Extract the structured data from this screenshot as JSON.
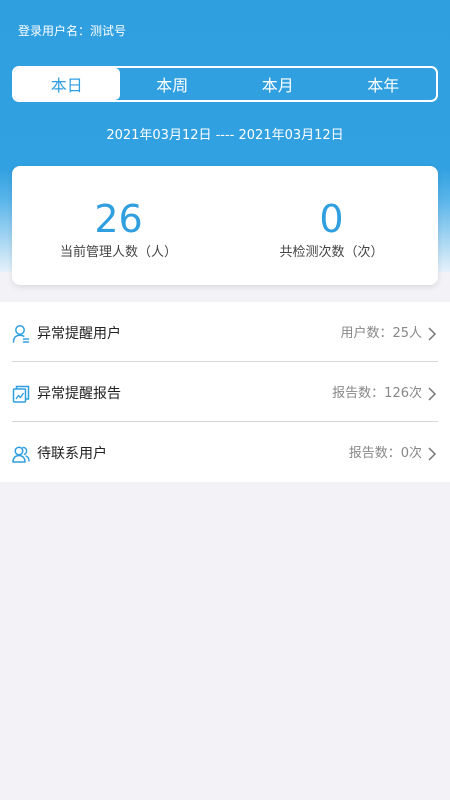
{
  "header": {
    "user_line": "登录用户名：测试号"
  },
  "tabs": [
    {
      "label": "本日",
      "active": true
    },
    {
      "label": "本周",
      "active": false
    },
    {
      "label": "本月",
      "active": false
    },
    {
      "label": "本年",
      "active": false
    }
  ],
  "date_range": "2021年03月12日 ---- 2021年03月12日",
  "stats": {
    "managed_people": {
      "value": "26",
      "label": "当前管理人数（人）"
    },
    "test_count": {
      "value": "0",
      "label": "共检测次数（次）"
    }
  },
  "list": [
    {
      "title": "异常提醒用户",
      "value": "用户数：25人",
      "icon": "user-alert-icon"
    },
    {
      "title": "异常提醒报告",
      "value": "报告数：126次",
      "icon": "report-chart-icon"
    },
    {
      "title": "待联系用户",
      "value": "报告数：0次",
      "icon": "contact-users-icon"
    }
  ],
  "colors": {
    "accent": "#2f9fe0",
    "background": "#f3f2f6"
  }
}
